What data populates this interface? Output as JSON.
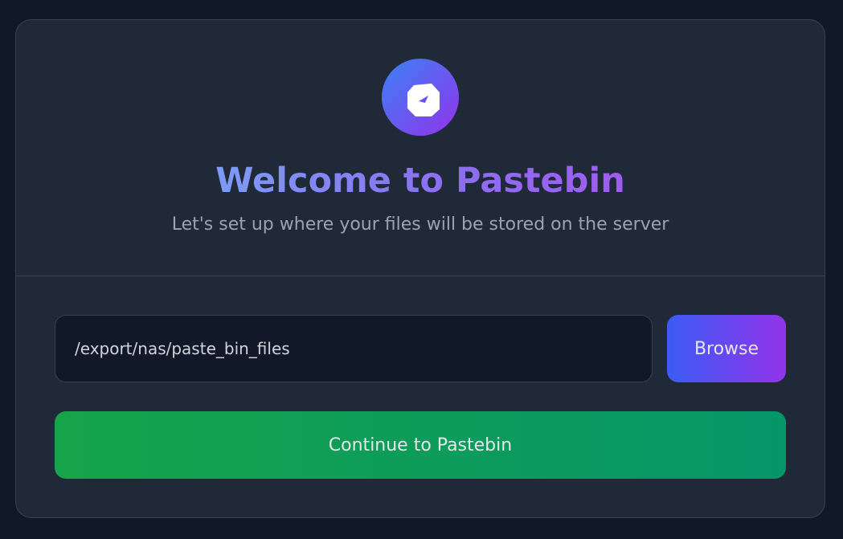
{
  "header": {
    "logo_icon": "compass-icon",
    "title": "Welcome to Pastebin",
    "subtitle": "Let's set up where your files will be stored on the server"
  },
  "form": {
    "path_value": "/export/nas/paste_bin_files",
    "browse_label": "Browse",
    "continue_label": "Continue to Pastebin"
  },
  "colors": {
    "background": "#111827",
    "card": "#1f2937",
    "accent_gradient_start": "#3b82f6",
    "accent_gradient_end": "#9333ea",
    "success_gradient_start": "#16a34a",
    "success_gradient_end": "#059669"
  }
}
